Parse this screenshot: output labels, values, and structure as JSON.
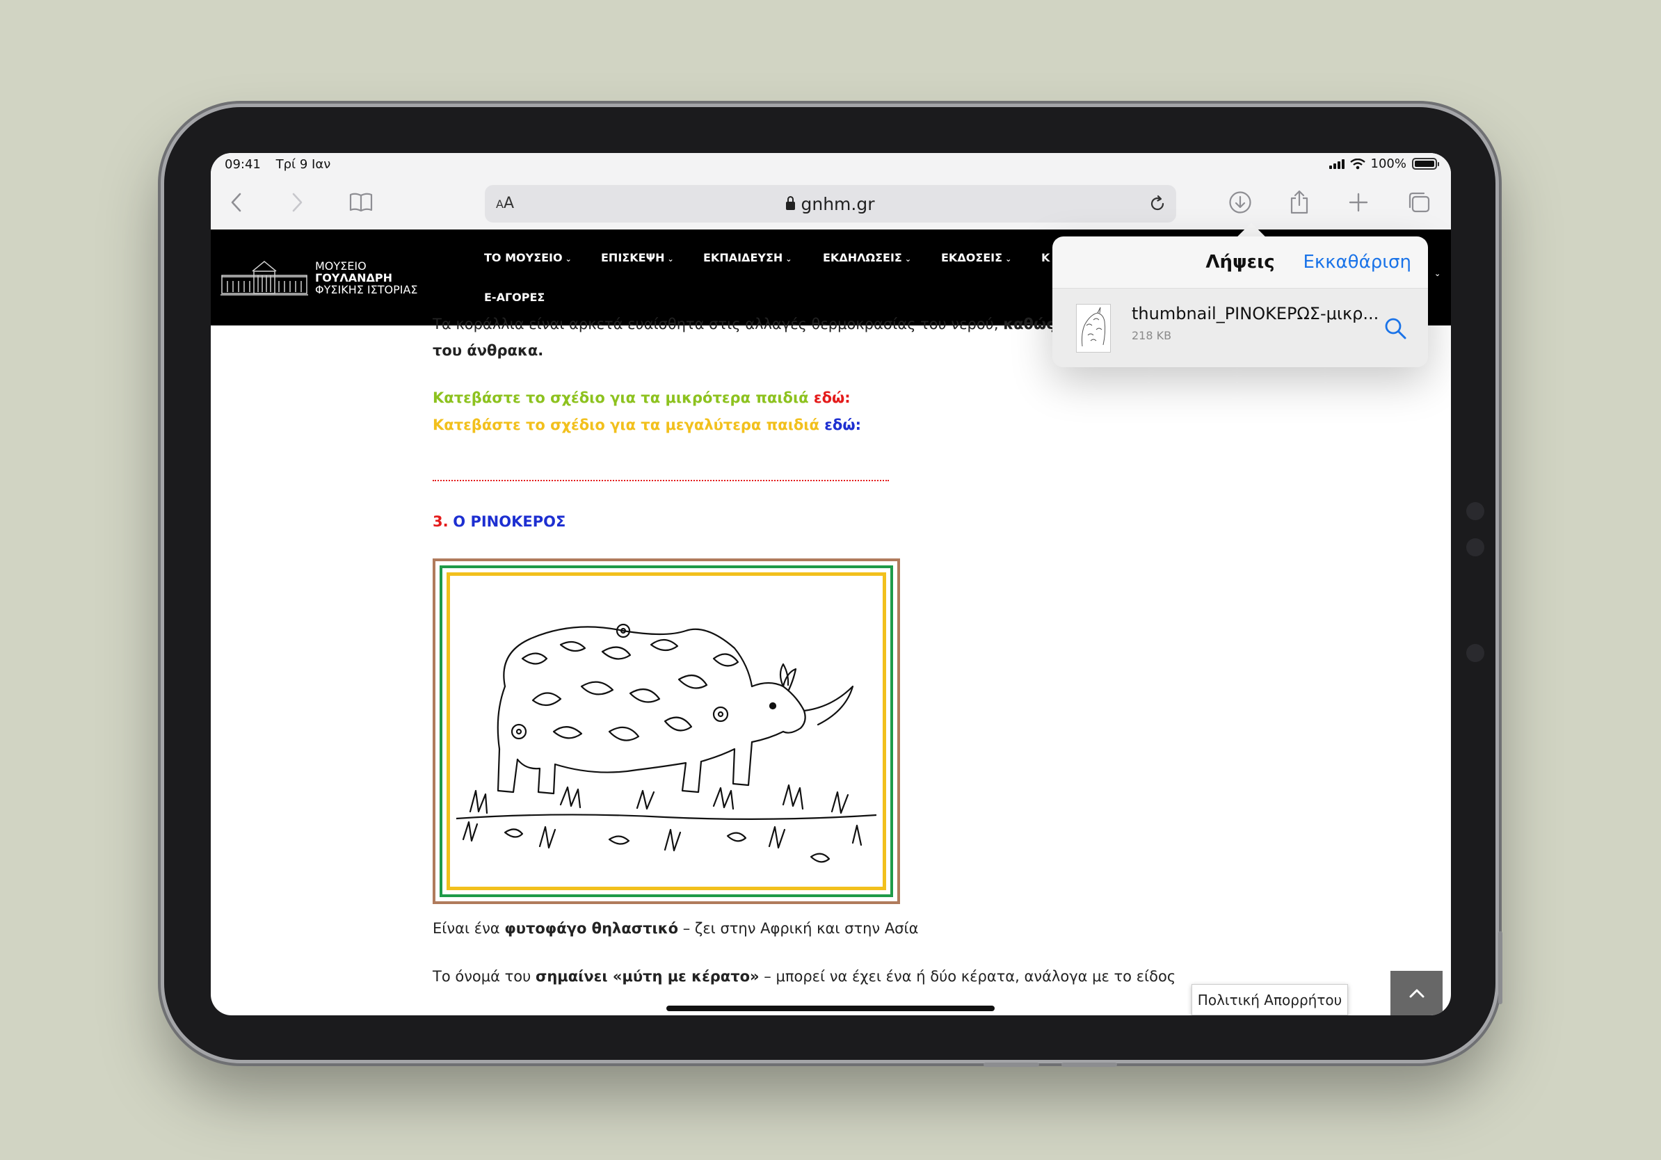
{
  "status_bar": {
    "time": "09:41",
    "date": "Τρί 9 Ιαν",
    "battery_percent": "100%"
  },
  "toolbar": {
    "reader_label_small": "A",
    "reader_label_large": "A",
    "url": "gnhm.gr"
  },
  "site": {
    "logo_line1": "ΜΟΥΣΕΙΟ",
    "logo_line2": "ΓΟΥΛΑΝΔΡΗ",
    "logo_line3": "ΦΥΣΙΚΗΣ ΙΣΤΟΡΙΑΣ",
    "nav": [
      {
        "label": "ΤΟ ΜΟΥΣΕΙΟ"
      },
      {
        "label": "ΕΠΙΣΚΕΨΗ"
      },
      {
        "label": "ΕΚΠΑΙΔΕΥΣΗ"
      },
      {
        "label": "ΕΚΔΗΛΩΣΕΙΣ"
      },
      {
        "label": "ΕΚΔΟΣΕΙΣ"
      },
      {
        "label": "Κ"
      }
    ],
    "nav_second_row": "Ε-ΑΓΟΡΕΣ"
  },
  "content": {
    "line_partial_a": "Τα κοράλλια είναι αρκετά ευαίσθητα στις αλλαγές θερμοκρασίας του νερού, ",
    "line_partial_bold": "καθώς και στ",
    "line2": "του άνθρακα.",
    "download_small_text": "Κατεβάστε το σχέδιο για τα μικρότερα παιδιά ",
    "download_small_link": "εδώ:",
    "download_big_text": "Κατεβάστε το σχέδιο για τα μεγαλύτερα παιδιά ",
    "download_big_link": "εδώ:",
    "section_number": "3.",
    "section_title": "Ο ΡΙΝΟΚΕΡΟΣ",
    "fact1_pre": "Είναι ένα ",
    "fact1_bold": "φυτοφάγο θηλαστικό",
    "fact1_post": " – ζει στην Αφρική και στην Ασία",
    "fact2_pre": "Το όνομά του ",
    "fact2_bold": "σημαίνει «μύτη με κέρατο»",
    "fact2_post": " – μπορεί να έχει ένα ή δύο κέρατα, ανάλογα με το είδος"
  },
  "privacy_label": "Πολιτική Απορρήτου",
  "downloads": {
    "title": "Λήψεις",
    "clear_label": "Εκκαθάριση",
    "items": [
      {
        "name": "thumbnail_ΡΙΝΟΚΕΡΩΣ-μικρ...",
        "size": "218 KB"
      }
    ]
  },
  "colors": {
    "accent_blue": "#1a73e8",
    "text_green": "#8dc21f",
    "text_yellow": "#f2c01d",
    "text_red": "#e41b1b",
    "text_blue": "#1d2fd1"
  }
}
